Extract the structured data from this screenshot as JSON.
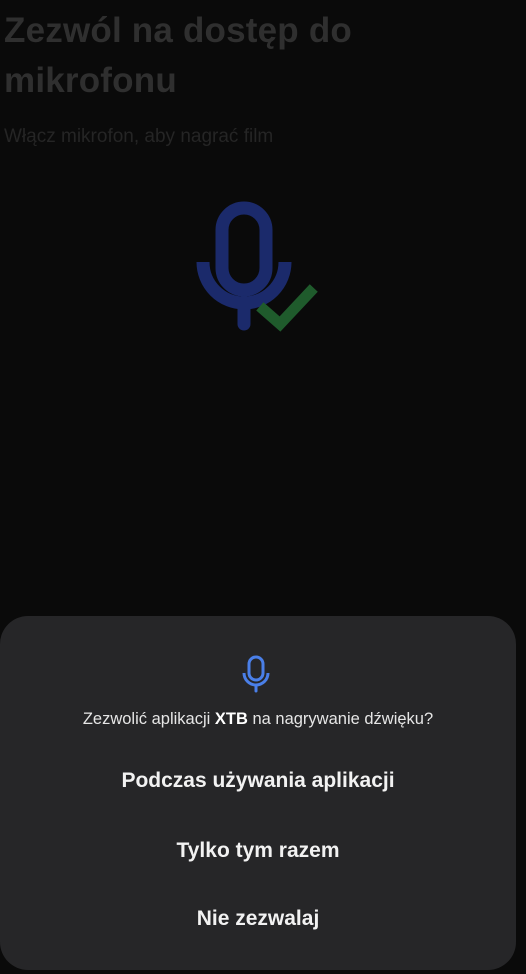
{
  "background": {
    "title": "Zezwól na dostęp do mikrofonu",
    "subtitle": "Włącz mikrofon, aby nagrać film",
    "graphic_icon": "microphone-with-checkmark-icon"
  },
  "dialog": {
    "icon": "microphone-icon",
    "question_prefix": "Zezwolić aplikacji ",
    "app_name": "XTB",
    "question_suffix": " na nagrywanie dźwięku?",
    "buttons": {
      "while_using": "Podczas używania aplikacji",
      "only_once": "Tylko tym razem",
      "deny": "Nie zezwalaj"
    }
  },
  "colors": {
    "mic_navy": "#1b2a6b",
    "check_green": "#1f5b2c",
    "dialog_mic_blue": "#4a7fe8",
    "sheet_bg": "#262628"
  }
}
